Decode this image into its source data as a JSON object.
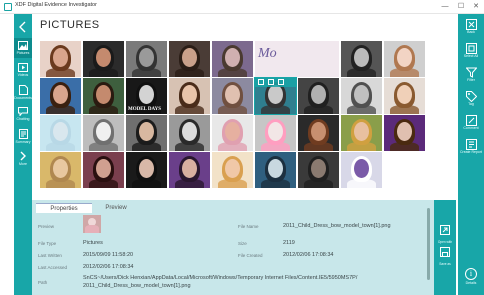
{
  "window": {
    "title": "XDF Digital Evidence Investigator",
    "minimize": "—",
    "maximize": "☐",
    "close": "✕"
  },
  "left_rail": {
    "items": [
      {
        "label": "",
        "icon": "back-arrow-icon"
      },
      {
        "label": "Pictures",
        "icon": "pictures-icon"
      },
      {
        "label": "Videos",
        "icon": "videos-icon"
      },
      {
        "label": "Documents",
        "icon": "documents-icon"
      },
      {
        "label": "Chatting",
        "icon": "chatting-icon"
      },
      {
        "label": "Summary",
        "icon": "summary-icon"
      },
      {
        "label": "More",
        "icon": "more-chevron-icon"
      }
    ]
  },
  "page": {
    "title": "PICTURES"
  },
  "gallery": {
    "mod_text": "Mo",
    "caption": "MODEL DAYS",
    "thumbnails": [
      {
        "bg": "#e8d2c8",
        "skin": "#d9a58d",
        "hair": "#6b3a1e"
      },
      {
        "bg": "#2b2b2b",
        "skin": "#c48a6e",
        "hair": "#1a1a1a"
      },
      {
        "bg": "#7a7a7a",
        "skin": "#9a9a9a",
        "hair": "#333333"
      },
      {
        "bg": "#4a3c36",
        "skin": "#c9a08a",
        "hair": "#2a1d16"
      },
      {
        "bg": "#7c6a8e",
        "skin": "#d0b0b0",
        "hair": "#4a3a30"
      },
      {
        "bg": "#f1e8ee",
        "skin": "#f0d8d8",
        "hair": "#6a5a9a"
      },
      {
        "bg": "#f1e8ee",
        "skin": "#f0d8d8",
        "hair": "#6a5a9a"
      },
      {
        "bg": "#555555",
        "skin": "#bbbbbb",
        "hair": "#222222"
      },
      {
        "bg": "#cfcfcf",
        "skin": "#f2d4c4",
        "hair": "#b07850"
      },
      {
        "bg": "#3a6ea8",
        "skin": "#d9a58d",
        "hair": "#3a2010"
      },
      {
        "bg": "#3e5f3e",
        "skin": "#c48a6e",
        "hair": "#2a1a10"
      },
      {
        "bg": "#181818",
        "skin": "#d3d3d3",
        "hair": "#101010"
      },
      {
        "bg": "#d7c2b3",
        "skin": "#e8c4aa",
        "hair": "#4a2c1a"
      },
      {
        "bg": "#8c8aa0",
        "skin": "#e0c0b0",
        "hair": "#705040"
      },
      {
        "bg": "#2f7f8f",
        "skin": "#c9c9c9",
        "hair": "#333333"
      },
      {
        "bg": "#444444",
        "skin": "#b0b0b0",
        "hair": "#202020"
      },
      {
        "bg": "#d8d8d8",
        "skin": "#c0c0c0",
        "hair": "#505050"
      },
      {
        "bg": "#e6ddd6",
        "skin": "#f0d0b8",
        "hair": "#8a5a30"
      },
      {
        "bg": "#c7e6f0",
        "skin": "#d9e7ee",
        "hair": "#b8d8e6"
      },
      {
        "bg": "#bdbdbd",
        "skin": "#f0f0f0",
        "hair": "#707070"
      },
      {
        "bg": "#6f6f6f",
        "skin": "#d8b8a0",
        "hair": "#1c1c1c"
      },
      {
        "bg": "#9a9a9a",
        "skin": "#dcdcdc",
        "hair": "#2a2a2a"
      },
      {
        "bg": "#e8e8e8",
        "skin": "#e6b0a0",
        "hair": "#e0a0b0"
      },
      {
        "bg": "#c6c6c6",
        "skin": "#f2e6e6",
        "hair": "#ff9ec0"
      },
      {
        "bg": "#2a2a2a",
        "skin": "#c89070",
        "hair": "#703c20"
      },
      {
        "bg": "#8a9e4a",
        "skin": "#e8c0a0",
        "hair": "#d0a040"
      },
      {
        "bg": "#5b2a7a",
        "skin": "#e0c0b0",
        "hair": "#4a2a10"
      },
      {
        "bg": "#d9b86a",
        "skin": "#e8c8a0",
        "hair": "#b08850"
      },
      {
        "bg": "#7a3f4e",
        "skin": "#d0a090",
        "hair": "#2a1010"
      },
      {
        "bg": "#1a1a1a",
        "skin": "#d8b8a8",
        "hair": "#101010"
      },
      {
        "bg": "#6a3f8a",
        "skin": "#d8b0a0",
        "hair": "#2a1830"
      },
      {
        "bg": "#f2e2c8",
        "skin": "#f0c8a8",
        "hair": "#d9a050"
      },
      {
        "bg": "#2f5f7f",
        "skin": "#c8d8e0",
        "hair": "#1c3040"
      },
      {
        "bg": "#3a3a3a",
        "skin": "#8a7a70",
        "hair": "#202020"
      },
      {
        "bg": "#d8d8e8",
        "skin": "#7a5aa8",
        "hair": "#ffffff"
      },
      {
        "bg": "#ffffff",
        "skin": "#ffffff",
        "hair": "#ffffff"
      }
    ]
  },
  "right_rail": {
    "items": [
      {
        "label": "Back",
        "icon": "close-x-icon"
      },
      {
        "label": "Select All",
        "icon": "select-all-icon"
      },
      {
        "label": "Filter",
        "icon": "filter-icon"
      },
      {
        "label": "Tag",
        "icon": "tag-icon"
      },
      {
        "label": "Comment",
        "icon": "comment-icon"
      },
      {
        "label": "Create Report",
        "icon": "create-report-icon"
      }
    ],
    "details_label": "Details",
    "details_icon": "i"
  },
  "details": {
    "tabs": [
      "Properties",
      "Preview"
    ],
    "fields": {
      "preview_label": "Preview",
      "file_name_label": "File Name",
      "file_name": "2011_Child_Dress_bow_model_town[1].png",
      "file_type_label": "File Type",
      "file_type": "Pictures",
      "size_label": "Size",
      "size": "2119",
      "last_written_label": "Last Written",
      "last_written": "2015/09/09 11:58:20",
      "file_created_label": "File Created",
      "file_created": "2012/02/06 17:08:34",
      "last_accessed_label": "Last Accessed",
      "last_accessed": "2012/02/06 17:08:34",
      "path_label": "Path",
      "path_line1": "SnCS~/Users/Dick Henxian/AppData/Local/Microsoft/Windows/Temporary Internet Files/Content.IE5/5950MS7P/",
      "path_line2": "2011_Child_Dress_bow_model_town[1].png"
    },
    "side_strip": [
      {
        "label": "Open with",
        "icon": "open-with-icon"
      },
      {
        "label": "Save as",
        "icon": "save-as-icon"
      }
    ]
  },
  "colors": {
    "accent": "#18a6a8",
    "accent_dark": "#0d8b8d",
    "details_bg": "#c8e7ea"
  }
}
